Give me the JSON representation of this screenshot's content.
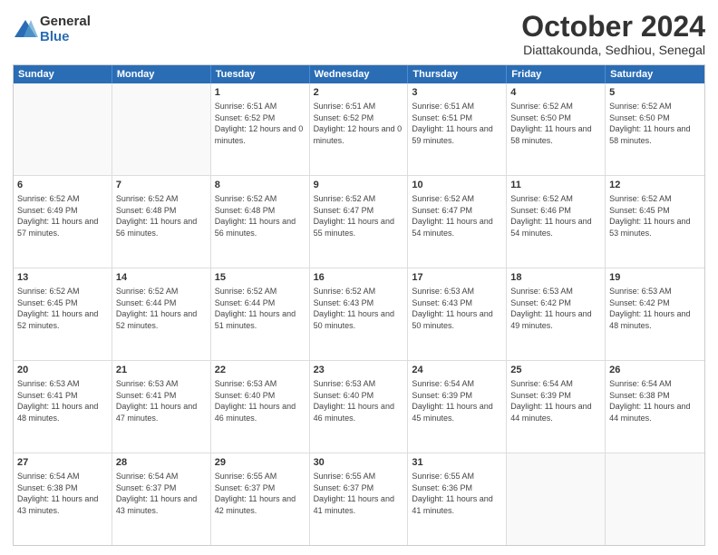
{
  "logo": {
    "general": "General",
    "blue": "Blue"
  },
  "title": {
    "month": "October 2024",
    "location": "Diattakounda, Sedhiou, Senegal"
  },
  "header_days": [
    "Sunday",
    "Monday",
    "Tuesday",
    "Wednesday",
    "Thursday",
    "Friday",
    "Saturday"
  ],
  "weeks": [
    [
      {
        "day": "",
        "sunrise": "",
        "sunset": "",
        "daylight": ""
      },
      {
        "day": "",
        "sunrise": "",
        "sunset": "",
        "daylight": ""
      },
      {
        "day": "1",
        "sunrise": "Sunrise: 6:51 AM",
        "sunset": "Sunset: 6:52 PM",
        "daylight": "Daylight: 12 hours and 0 minutes."
      },
      {
        "day": "2",
        "sunrise": "Sunrise: 6:51 AM",
        "sunset": "Sunset: 6:52 PM",
        "daylight": "Daylight: 12 hours and 0 minutes."
      },
      {
        "day": "3",
        "sunrise": "Sunrise: 6:51 AM",
        "sunset": "Sunset: 6:51 PM",
        "daylight": "Daylight: 11 hours and 59 minutes."
      },
      {
        "day": "4",
        "sunrise": "Sunrise: 6:52 AM",
        "sunset": "Sunset: 6:50 PM",
        "daylight": "Daylight: 11 hours and 58 minutes."
      },
      {
        "day": "5",
        "sunrise": "Sunrise: 6:52 AM",
        "sunset": "Sunset: 6:50 PM",
        "daylight": "Daylight: 11 hours and 58 minutes."
      }
    ],
    [
      {
        "day": "6",
        "sunrise": "Sunrise: 6:52 AM",
        "sunset": "Sunset: 6:49 PM",
        "daylight": "Daylight: 11 hours and 57 minutes."
      },
      {
        "day": "7",
        "sunrise": "Sunrise: 6:52 AM",
        "sunset": "Sunset: 6:48 PM",
        "daylight": "Daylight: 11 hours and 56 minutes."
      },
      {
        "day": "8",
        "sunrise": "Sunrise: 6:52 AM",
        "sunset": "Sunset: 6:48 PM",
        "daylight": "Daylight: 11 hours and 56 minutes."
      },
      {
        "day": "9",
        "sunrise": "Sunrise: 6:52 AM",
        "sunset": "Sunset: 6:47 PM",
        "daylight": "Daylight: 11 hours and 55 minutes."
      },
      {
        "day": "10",
        "sunrise": "Sunrise: 6:52 AM",
        "sunset": "Sunset: 6:47 PM",
        "daylight": "Daylight: 11 hours and 54 minutes."
      },
      {
        "day": "11",
        "sunrise": "Sunrise: 6:52 AM",
        "sunset": "Sunset: 6:46 PM",
        "daylight": "Daylight: 11 hours and 54 minutes."
      },
      {
        "day": "12",
        "sunrise": "Sunrise: 6:52 AM",
        "sunset": "Sunset: 6:45 PM",
        "daylight": "Daylight: 11 hours and 53 minutes."
      }
    ],
    [
      {
        "day": "13",
        "sunrise": "Sunrise: 6:52 AM",
        "sunset": "Sunset: 6:45 PM",
        "daylight": "Daylight: 11 hours and 52 minutes."
      },
      {
        "day": "14",
        "sunrise": "Sunrise: 6:52 AM",
        "sunset": "Sunset: 6:44 PM",
        "daylight": "Daylight: 11 hours and 52 minutes."
      },
      {
        "day": "15",
        "sunrise": "Sunrise: 6:52 AM",
        "sunset": "Sunset: 6:44 PM",
        "daylight": "Daylight: 11 hours and 51 minutes."
      },
      {
        "day": "16",
        "sunrise": "Sunrise: 6:52 AM",
        "sunset": "Sunset: 6:43 PM",
        "daylight": "Daylight: 11 hours and 50 minutes."
      },
      {
        "day": "17",
        "sunrise": "Sunrise: 6:53 AM",
        "sunset": "Sunset: 6:43 PM",
        "daylight": "Daylight: 11 hours and 50 minutes."
      },
      {
        "day": "18",
        "sunrise": "Sunrise: 6:53 AM",
        "sunset": "Sunset: 6:42 PM",
        "daylight": "Daylight: 11 hours and 49 minutes."
      },
      {
        "day": "19",
        "sunrise": "Sunrise: 6:53 AM",
        "sunset": "Sunset: 6:42 PM",
        "daylight": "Daylight: 11 hours and 48 minutes."
      }
    ],
    [
      {
        "day": "20",
        "sunrise": "Sunrise: 6:53 AM",
        "sunset": "Sunset: 6:41 PM",
        "daylight": "Daylight: 11 hours and 48 minutes."
      },
      {
        "day": "21",
        "sunrise": "Sunrise: 6:53 AM",
        "sunset": "Sunset: 6:41 PM",
        "daylight": "Daylight: 11 hours and 47 minutes."
      },
      {
        "day": "22",
        "sunrise": "Sunrise: 6:53 AM",
        "sunset": "Sunset: 6:40 PM",
        "daylight": "Daylight: 11 hours and 46 minutes."
      },
      {
        "day": "23",
        "sunrise": "Sunrise: 6:53 AM",
        "sunset": "Sunset: 6:40 PM",
        "daylight": "Daylight: 11 hours and 46 minutes."
      },
      {
        "day": "24",
        "sunrise": "Sunrise: 6:54 AM",
        "sunset": "Sunset: 6:39 PM",
        "daylight": "Daylight: 11 hours and 45 minutes."
      },
      {
        "day": "25",
        "sunrise": "Sunrise: 6:54 AM",
        "sunset": "Sunset: 6:39 PM",
        "daylight": "Daylight: 11 hours and 44 minutes."
      },
      {
        "day": "26",
        "sunrise": "Sunrise: 6:54 AM",
        "sunset": "Sunset: 6:38 PM",
        "daylight": "Daylight: 11 hours and 44 minutes."
      }
    ],
    [
      {
        "day": "27",
        "sunrise": "Sunrise: 6:54 AM",
        "sunset": "Sunset: 6:38 PM",
        "daylight": "Daylight: 11 hours and 43 minutes."
      },
      {
        "day": "28",
        "sunrise": "Sunrise: 6:54 AM",
        "sunset": "Sunset: 6:37 PM",
        "daylight": "Daylight: 11 hours and 43 minutes."
      },
      {
        "day": "29",
        "sunrise": "Sunrise: 6:55 AM",
        "sunset": "Sunset: 6:37 PM",
        "daylight": "Daylight: 11 hours and 42 minutes."
      },
      {
        "day": "30",
        "sunrise": "Sunrise: 6:55 AM",
        "sunset": "Sunset: 6:37 PM",
        "daylight": "Daylight: 11 hours and 41 minutes."
      },
      {
        "day": "31",
        "sunrise": "Sunrise: 6:55 AM",
        "sunset": "Sunset: 6:36 PM",
        "daylight": "Daylight: 11 hours and 41 minutes."
      },
      {
        "day": "",
        "sunrise": "",
        "sunset": "",
        "daylight": ""
      },
      {
        "day": "",
        "sunrise": "",
        "sunset": "",
        "daylight": ""
      }
    ]
  ]
}
